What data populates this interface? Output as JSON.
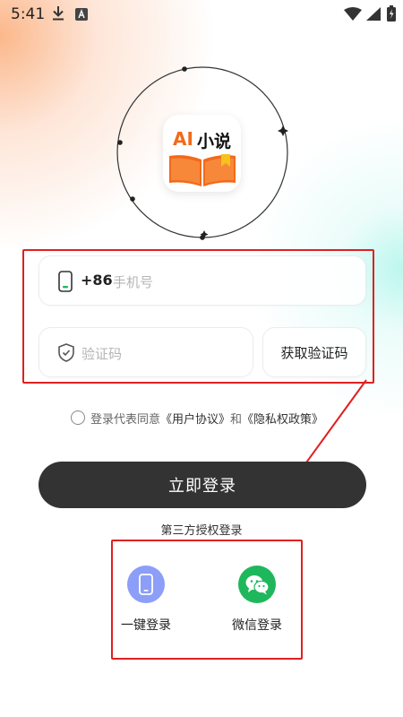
{
  "status_bar": {
    "time": "5:41"
  },
  "logo": {
    "text_ai": "AI",
    "text_cn": "小说",
    "ai_color": "#f26a1b"
  },
  "form": {
    "country_code": "+86",
    "phone_placeholder": "手机号",
    "code_placeholder": "验证码",
    "get_code_label": "获取验证码"
  },
  "agreement": {
    "prefix": "登录代表同意",
    "user_agreement": "《用户协议》",
    "and": "和",
    "privacy_policy": "《隐私权政策》"
  },
  "login_button_label": "立即登录",
  "third_party": {
    "title": "第三方授权登录",
    "options": [
      {
        "label": "一键登录",
        "icon": "phone-icon",
        "color": "#8c9ef7"
      },
      {
        "label": "微信登录",
        "icon": "wechat-icon",
        "color": "#1fb75b"
      }
    ]
  },
  "colors": {
    "highlight": "#e02020",
    "button": "#333333",
    "accent_orange": "#f26a1b"
  }
}
